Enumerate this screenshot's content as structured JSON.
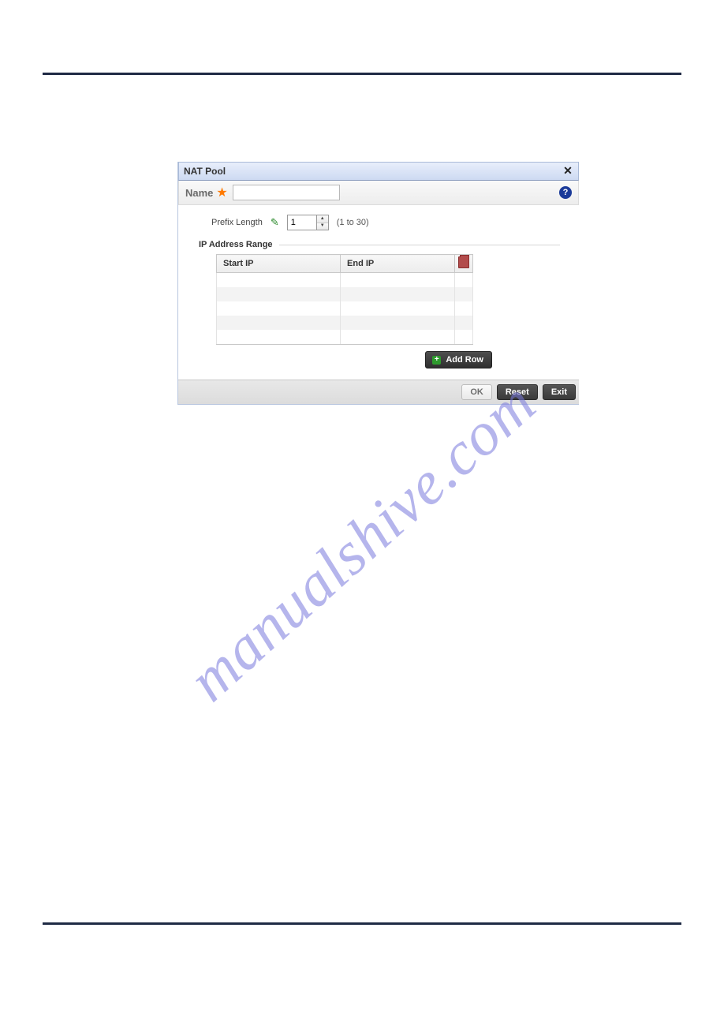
{
  "watermark": "manualshive.com",
  "dialog": {
    "title": "NAT Pool",
    "name_label": "Name",
    "prefix_label": "Prefix Length",
    "prefix_value": "1",
    "prefix_hint": "(1 to 30)",
    "range_label": "IP Address Range",
    "columns": {
      "start": "Start IP",
      "end": "End IP"
    },
    "addrow_label": "Add Row",
    "buttons": {
      "ok": "OK",
      "reset": "Reset",
      "exit": "Exit"
    }
  }
}
